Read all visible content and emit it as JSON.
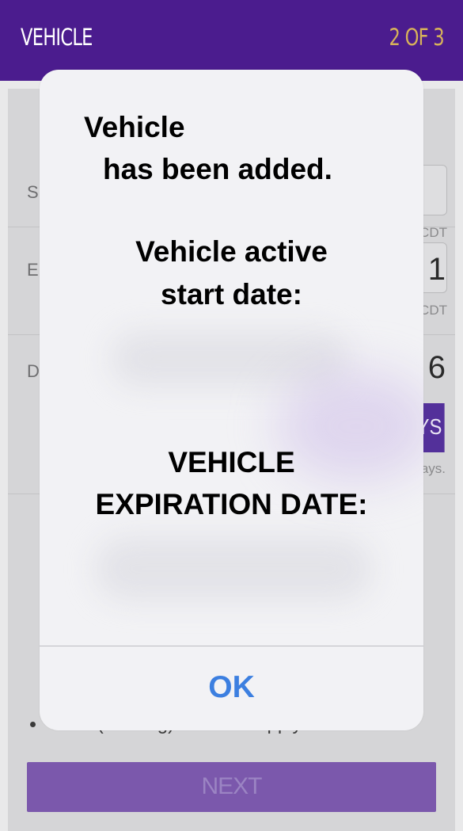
{
  "header": {
    "title": "VEHICLE",
    "step": "2 OF 3"
  },
  "form": {
    "rows": [
      {
        "label": "S",
        "value": "",
        "timezone": "CDT"
      },
      {
        "label": "E",
        "value": "1",
        "timezone": "CDT"
      },
      {
        "label": "D",
        "value": "6"
      }
    ],
    "days_button": "YS",
    "days_note": "ays.",
    "bullet": "Cash (non-tag) toll rates apply.",
    "next_label": "NEXT"
  },
  "dialog": {
    "line1": "Vehicle",
    "line2": "has been added.",
    "start_label_1": "Vehicle active",
    "start_label_2": "start date:",
    "exp_label_1": "VEHICLE",
    "exp_label_2": "EXPIRATION DATE:",
    "ok_label": "OK"
  },
  "colors": {
    "header_bg": "#4b1c8e",
    "step_text": "#d7b25a",
    "ok_text": "#3c7fe0",
    "next_bg": "#7b58ac"
  }
}
